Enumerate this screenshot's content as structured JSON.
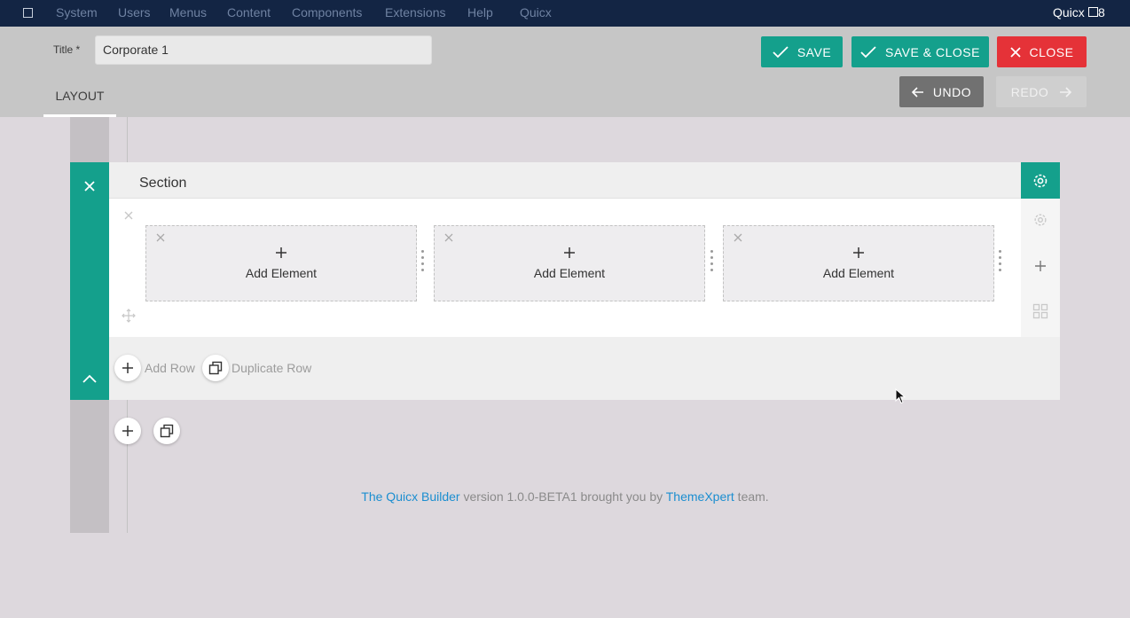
{
  "topbar": {
    "menu": [
      "System",
      "Users",
      "Menus",
      "Content",
      "Components",
      "Extensions",
      "Help",
      "Quicx"
    ],
    "brand": "Quicx",
    "count": "8"
  },
  "header": {
    "title_label": "Title *",
    "title_value": "Corporate 1",
    "save_label": "SAVE",
    "save_close_label": "SAVE & CLOSE",
    "close_label": "CLOSE",
    "undo_label": "UNDO",
    "redo_label": "REDO",
    "tab_label": "LAYOUT"
  },
  "section": {
    "title": "Section",
    "columns": [
      {
        "label": "Add Element"
      },
      {
        "label": "Add Element"
      },
      {
        "label": "Add Element"
      }
    ],
    "add_row_label": "Add Row",
    "duplicate_row_label": "Duplicate Row"
  },
  "footer": {
    "link1": "The Quicx Builder",
    "text1": " version 1.0.0-BETA1 brought you by ",
    "link2": "ThemeXpert",
    "text2": " team."
  },
  "colors": {
    "topbar": "#132544",
    "accent_teal": "#14a08c",
    "close_red": "#e53238",
    "undo_gray": "#717171",
    "link_blue": "#1b8ed0"
  }
}
